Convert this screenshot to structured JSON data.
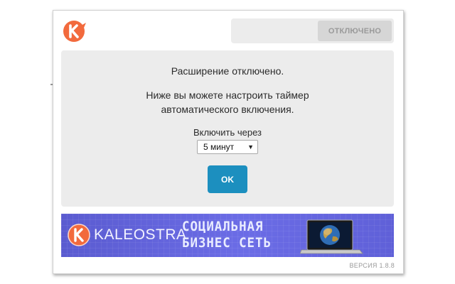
{
  "header": {
    "logo_icon": "kaleostra-k-icon",
    "logo_color": "#f26a3d",
    "toggle": {
      "status_label": "ОТКЛЮЧЕНО"
    }
  },
  "panel": {
    "message_title": "Расширение отключено.",
    "message_body": "Ниже вы можете настроить таймер автоматического включения.",
    "timer_label": "Включить через",
    "timer_select": {
      "value": "5 минут"
    },
    "ok_label": "OK",
    "accent_color": "#1c8fbf"
  },
  "banner": {
    "brand": "KALEOSTRA",
    "slogan_line1": "СОЦИАЛЬНАЯ",
    "slogan_line2": "БИЗНЕС СЕТЬ",
    "image_icon": "laptop-globe-icon"
  },
  "footer": {
    "version": "ВЕРСИЯ 1.8.8"
  }
}
